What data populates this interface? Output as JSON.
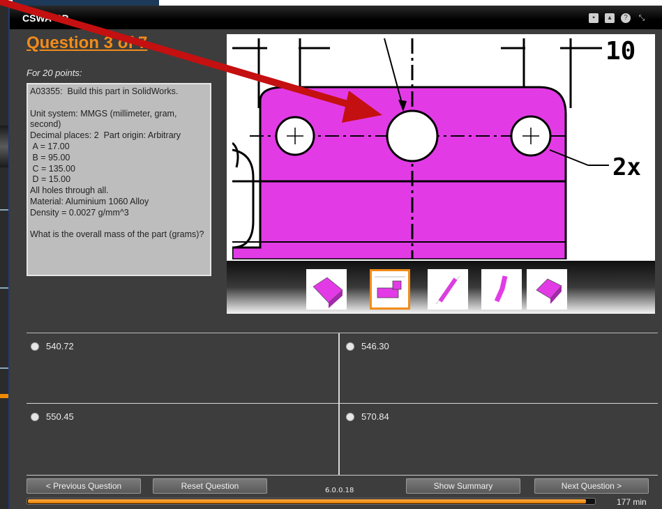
{
  "window": {
    "title": "CSWA-RP"
  },
  "titlebar_icons": [
    "print-icon",
    "home-icon",
    "help-icon",
    "collapse-icon"
  ],
  "question": {
    "heading": "Question 3 of 7",
    "points": "For 20 points:",
    "text": "A03355:  Build this part in SolidWorks.\n\nUnit system: MMGS (millimeter, gram, second)\nDecimal places: 2  Part origin: Arbitrary\n A = 17.00\n B = 95.00\n C = 135.00\n D = 15.00\nAll holes through all.\nMaterial: Aluminium 1060 Alloy\nDensity = 0.0027 g/mm^3\n\nWhat is the overall mass of the part (grams)?"
  },
  "drawing": {
    "dim_top_right": "10",
    "callout": "2x"
  },
  "thumbnails": {
    "count": 5,
    "selected_index": 1
  },
  "answers": [
    {
      "label": "540.72"
    },
    {
      "label": "546.30"
    },
    {
      "label": "550.45"
    },
    {
      "label": "570.84"
    }
  ],
  "nav": {
    "previous": "< Previous Question",
    "reset": "Reset Question",
    "version": "6.0.0.18",
    "summary": "Show Summary",
    "next": "Next Question >"
  },
  "timer": {
    "remaining": "177 min",
    "progress_fraction": 0.985
  },
  "colors": {
    "accent": "#f28c1a",
    "part": "#e23be6",
    "arrow": "#c41010"
  }
}
